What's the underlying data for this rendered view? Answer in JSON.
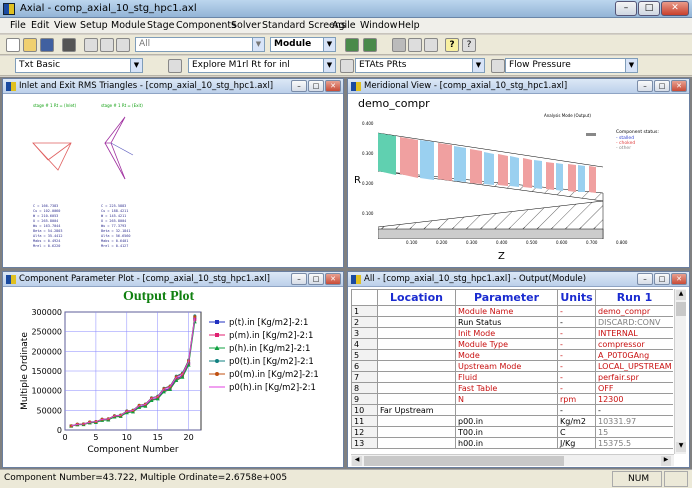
{
  "app": {
    "title": "Axial - comp_axial_10_stg_hpc1.axl"
  },
  "window_buttons": {
    "minimize": "–",
    "maximize": "□",
    "close": "✕"
  },
  "menu": [
    "File",
    "Edit",
    "View",
    "Setup",
    "Module",
    "Stage",
    "Components",
    "Solver",
    "Standard Screens",
    "Agile",
    "Window",
    "Help"
  ],
  "toolbar1": {
    "filter_value": "All",
    "module_value": "Module"
  },
  "toolbar2": {
    "txt_value": "Txt  Basic",
    "explore_value": "Explore  M1rl  Rt  for  inl",
    "etats_value": "ETAts  PRts",
    "flow_value": "Flow  Pressure"
  },
  "windows": {
    "triangles": {
      "title": "Inlet and Exit RMS Triangles - [comp_axial_10_stg_hpc1.axl]"
    },
    "meridional": {
      "title": "Meridional View - [comp_axial_10_stg_hpc1.axl]",
      "heading": "demo_compr",
      "mode_label": "Analysis Mode (Output)",
      "legend_title": "Component status:",
      "legend_items": [
        "- stalled",
        "- choked",
        "- other"
      ],
      "axis_r": "R",
      "axis_z": "Z",
      "y_ticks": [
        "0.400",
        "0.300",
        "0.200",
        "0.100"
      ],
      "x_ticks": [
        "0.100",
        "0.200",
        "0.300",
        "0.400",
        "0.500",
        "0.600",
        "0.700",
        "0.800"
      ]
    },
    "param_plot": {
      "title": "Component Parameter Plot - [comp_axial_10_stg_hpc1.axl]",
      "heading": "Output Plot"
    },
    "output": {
      "title": "All - [comp_axial_10_stg_hpc1.axl] - Output(Module)",
      "columns": [
        "",
        "Location",
        "Parameter",
        "Units",
        "Run 1"
      ],
      "rows": [
        {
          "n": "1",
          "loc": "",
          "param": "Module Name",
          "units": "-",
          "run": "demo_compr",
          "style": "red"
        },
        {
          "n": "2",
          "loc": "",
          "param": "Run Status",
          "units": "-",
          "run": "DISCARD:CONV",
          "style": "grayrun"
        },
        {
          "n": "3",
          "loc": "",
          "param": "Init Mode",
          "units": "-",
          "run": "INTERNAL",
          "style": "red"
        },
        {
          "n": "4",
          "loc": "",
          "param": "Module Type",
          "units": "-",
          "run": "compressor",
          "style": "red"
        },
        {
          "n": "5",
          "loc": "",
          "param": "Mode",
          "units": "-",
          "run": "A_P0T0GAng",
          "style": "red"
        },
        {
          "n": "6",
          "loc": "",
          "param": "Upstream Mode",
          "units": "-",
          "run": "LOCAL_UPSTREAM",
          "style": "red"
        },
        {
          "n": "7",
          "loc": "",
          "param": "Fluid",
          "units": "-",
          "run": "perfair.spr",
          "style": "red"
        },
        {
          "n": "8",
          "loc": "",
          "param": "Fast Table",
          "units": "-",
          "run": "OFF",
          "style": "red"
        },
        {
          "n": "9",
          "loc": "",
          "param": "N",
          "units": "rpm",
          "run": "12300",
          "style": "red"
        },
        {
          "n": "10",
          "loc": "Far Upstream",
          "param": "",
          "units": "-",
          "run": "-",
          "style": "plain"
        },
        {
          "n": "11",
          "loc": "",
          "param": "p00.in",
          "units": "Kg/m2",
          "run": "10331.97",
          "style": "grayrun"
        },
        {
          "n": "12",
          "loc": "",
          "param": "T00.in",
          "units": "C",
          "run": "15",
          "style": "grayrun"
        },
        {
          "n": "13",
          "loc": "",
          "param": "h00.in",
          "units": "J/Kg",
          "run": "15375.5",
          "style": "grayrun"
        }
      ]
    }
  },
  "chart_data": {
    "type": "line",
    "title": "Output Plot",
    "xlabel": "Component Number",
    "ylabel": "Multiple Ordinate",
    "xlim": [
      0,
      22
    ],
    "ylim": [
      0,
      300000
    ],
    "x_ticks": [
      "0",
      "5",
      "10",
      "15",
      "20"
    ],
    "y_ticks": [
      "0",
      "50000",
      "100000",
      "150000",
      "200000",
      "250000",
      "300000"
    ],
    "x": [
      1,
      2,
      3,
      4,
      5,
      6,
      7,
      8,
      9,
      10,
      11,
      12,
      13,
      14,
      15,
      16,
      17,
      18,
      19,
      20,
      21
    ],
    "series": [
      {
        "name": "p(t).in [Kg/m2]-2:1",
        "color": "#2030c0",
        "marker": "square",
        "values": [
          10332,
          14000,
          14500,
          19000,
          19800,
          25500,
          26500,
          34000,
          35500,
          45000,
          47000,
          59000,
          62000,
          77000,
          81000,
          100000,
          106000,
          130000,
          138000,
          170000,
          285000
        ]
      },
      {
        "name": "p(m).in [Kg/m2]-2:1",
        "color": "#e02070",
        "marker": "square",
        "values": [
          10000,
          13500,
          14000,
          18500,
          19300,
          25000,
          26000,
          33500,
          35000,
          44500,
          46500,
          58000,
          61000,
          76000,
          80000,
          98000,
          104000,
          128000,
          136000,
          168000,
          280000
        ]
      },
      {
        "name": "p(h).in [Kg/m2]-2:1",
        "color": "#10a040",
        "marker": "triangle",
        "values": [
          9800,
          13200,
          13700,
          18200,
          19000,
          24500,
          25500,
          33000,
          34500,
          44000,
          46000,
          57500,
          60500,
          75000,
          79000,
          97000,
          103000,
          126000,
          134000,
          165000,
          275000
        ]
      },
      {
        "name": "p0(t).in [Kg/m2]-2:1",
        "color": "#108080",
        "marker": "circle",
        "values": [
          10332,
          15000,
          15500,
          20500,
          21500,
          27500,
          28500,
          36500,
          38000,
          48500,
          50500,
          63000,
          66000,
          82000,
          86000,
          106000,
          112000,
          137000,
          145000,
          178000,
          290000
        ]
      },
      {
        "name": "p0(m).in [Kg/m2]-2:1",
        "color": "#c05010",
        "marker": "circle",
        "values": [
          10332,
          14800,
          15300,
          20200,
          21200,
          27200,
          28200,
          36000,
          37500,
          48000,
          50000,
          62500,
          65500,
          81000,
          85000,
          105000,
          111000,
          135000,
          143000,
          176000,
          288000
        ]
      },
      {
        "name": "p0(h).in [Kg/m2]-2:1",
        "color": "#e040e0",
        "marker": "none",
        "values": [
          10332,
          14600,
          15100,
          20000,
          21000,
          27000,
          28000,
          35800,
          37200,
          47600,
          49600,
          62000,
          65000,
          80500,
          84500,
          104000,
          110000,
          134000,
          142000,
          174000,
          286000
        ]
      }
    ]
  },
  "status": {
    "left": "Component Number=43.722, Multiple Ordinate=2.6758e+005",
    "right": "NUM"
  }
}
